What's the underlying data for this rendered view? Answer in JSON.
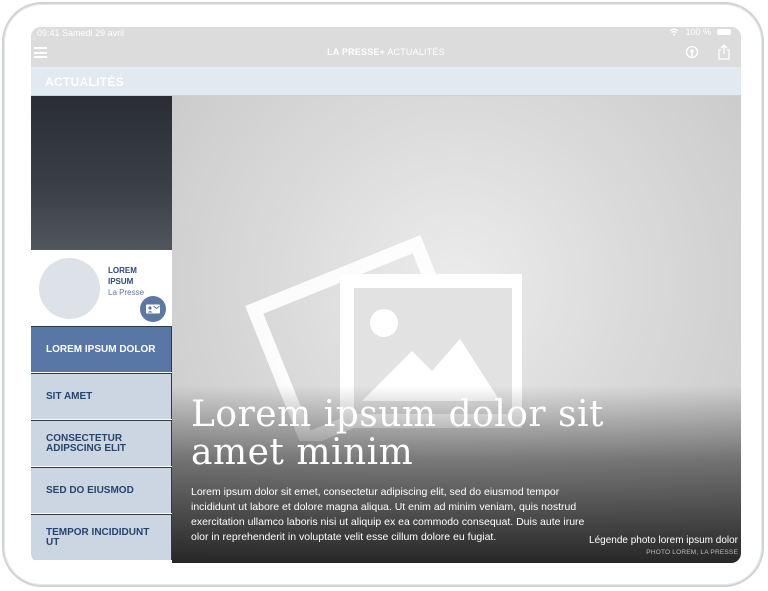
{
  "status_bar": {
    "time": "09:41",
    "date": "Samedi 29 avril",
    "battery": "100 %"
  },
  "nav": {
    "brand": "LA PRESSE+",
    "section": "ACTUALITÉS"
  },
  "section_header": {
    "label": "ACTUALITÉS"
  },
  "author": {
    "name": "LOREM IPSUM",
    "org": "La Presse"
  },
  "sidebar": {
    "items": [
      {
        "label": "LOREM IPSUM DOLOR",
        "active": true
      },
      {
        "label": "SIT AMET",
        "active": false
      },
      {
        "label": "CONSECTETUR ADIPSCING ELIT",
        "active": false
      },
      {
        "label": "SED DO EIUSMOD",
        "active": false
      },
      {
        "label": "TEMPOR INCIDIDUNT UT",
        "active": false
      }
    ]
  },
  "article": {
    "title": "Lorem ipsum dolor sit amet minim",
    "lede": "Lorem ipsum dolor sit emet, consectetur adipiscing elit, sed do eiusmod tempor incididunt ut labore et dolore magna aliqua. Ut enim ad minim veniam, quis nostrud exercitation ullamco laboris nisi ut aliquip ex ea commodo consequat. Duis aute irure olor in reprehenderit in voluptate velit esse cillum dolore eu fugiat.",
    "photo_caption": "Légende photo lorem ipsum dolor",
    "photo_credit": "PHOTO LOREM, LA PRESSE"
  },
  "colors": {
    "accent": "#5877a6",
    "nav_item_bg": "#ccd6e2",
    "section_bg": "#e3e9f1",
    "dark_text": "#264470"
  }
}
